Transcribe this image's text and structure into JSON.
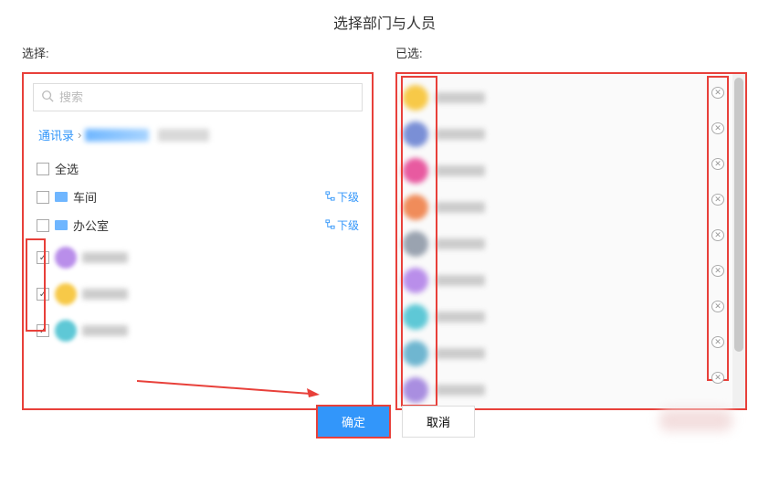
{
  "title": "选择部门与人员",
  "left": {
    "label": "选择:",
    "search_placeholder": "搜索",
    "breadcrumb_root": "通讯录",
    "select_all": "全选",
    "departments": [
      {
        "name": "车间",
        "sublevel": "下级"
      },
      {
        "name": "办公室",
        "sublevel": "下级"
      }
    ],
    "people": [
      {
        "checked": true,
        "avatar_color": "#b98eea"
      },
      {
        "checked": true,
        "avatar_color": "#f7c948"
      },
      {
        "checked": true,
        "avatar_color": "#5ec8d6"
      }
    ]
  },
  "right": {
    "label": "已选:",
    "selected": [
      {
        "avatar_color": "#f7c948"
      },
      {
        "avatar_color": "#7a8fd6"
      },
      {
        "avatar_color": "#e85aa0"
      },
      {
        "avatar_color": "#f08c5a"
      },
      {
        "avatar_color": "#9aa3b0"
      },
      {
        "avatar_color": "#b98eea"
      },
      {
        "avatar_color": "#5ec8d6"
      },
      {
        "avatar_color": "#6fb6d0"
      },
      {
        "avatar_color": "#a98ee0"
      }
    ]
  },
  "buttons": {
    "confirm": "确定",
    "cancel": "取消"
  }
}
